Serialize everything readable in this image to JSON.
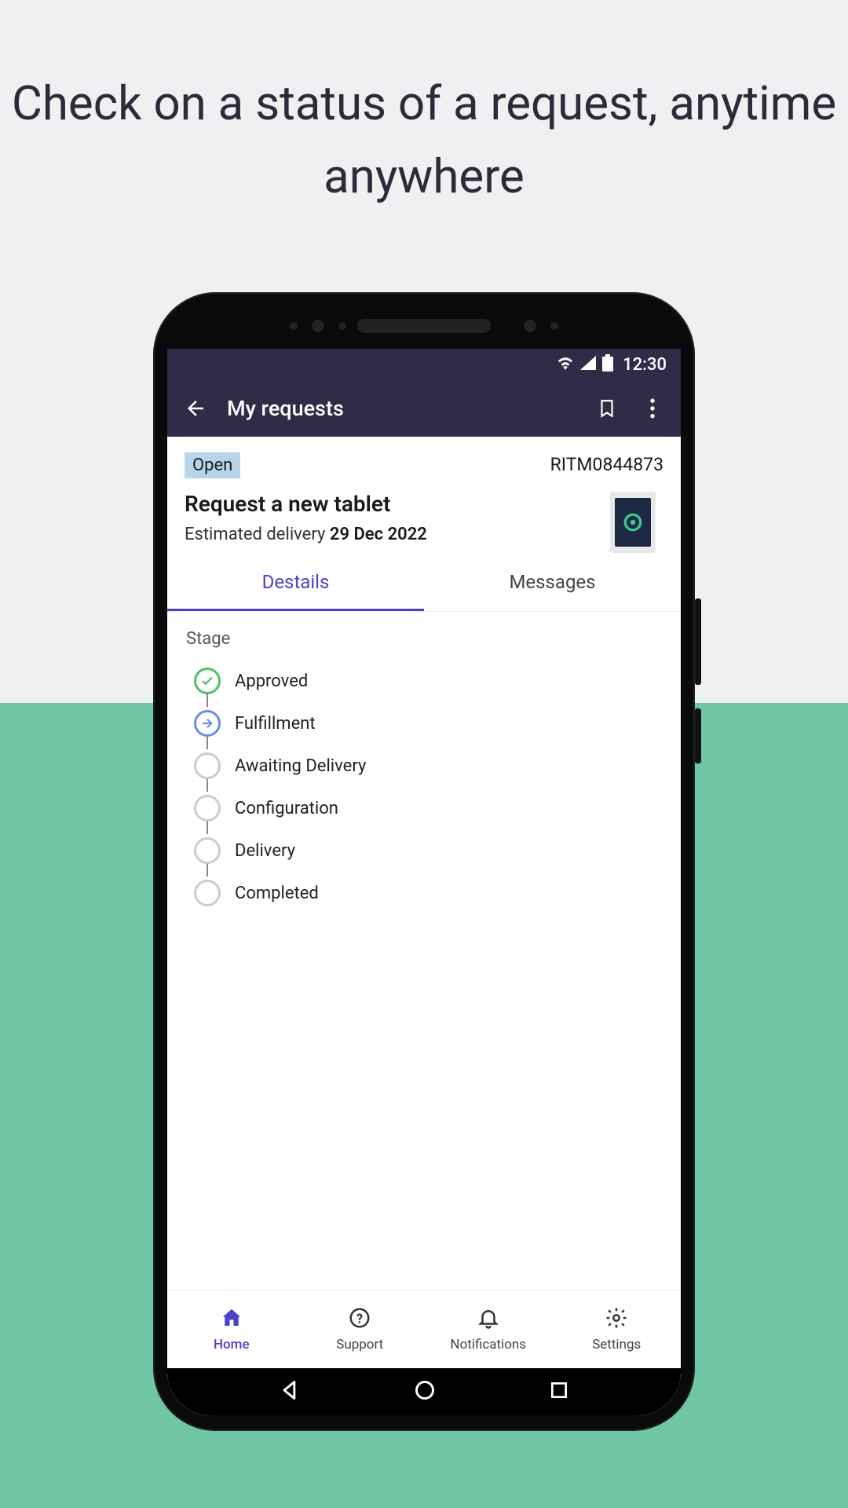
{
  "promo_headline": "Check on a status of a request, anytime anywhere",
  "status_bar": {
    "time": "12:30"
  },
  "app_bar": {
    "title": "My requests"
  },
  "request": {
    "status_badge": "Open",
    "id": "RITM0844873",
    "title": "Request a new tablet",
    "delivery_label": "Estimated delivery",
    "delivery_date": "29 Dec 2022"
  },
  "tabs": {
    "details": "Destails",
    "messages": "Messages"
  },
  "stage": {
    "label": "Stage",
    "items": [
      {
        "label": "Approved",
        "state": "done"
      },
      {
        "label": "Fulfillment",
        "state": "current"
      },
      {
        "label": "Awaiting Delivery",
        "state": "pending"
      },
      {
        "label": "Configuration",
        "state": "pending"
      },
      {
        "label": "Delivery",
        "state": "pending"
      },
      {
        "label": "Completed",
        "state": "pending"
      }
    ]
  },
  "bottom_nav": {
    "home": "Home",
    "support": "Support",
    "notifications": "Notifications",
    "settings": "Settings"
  }
}
